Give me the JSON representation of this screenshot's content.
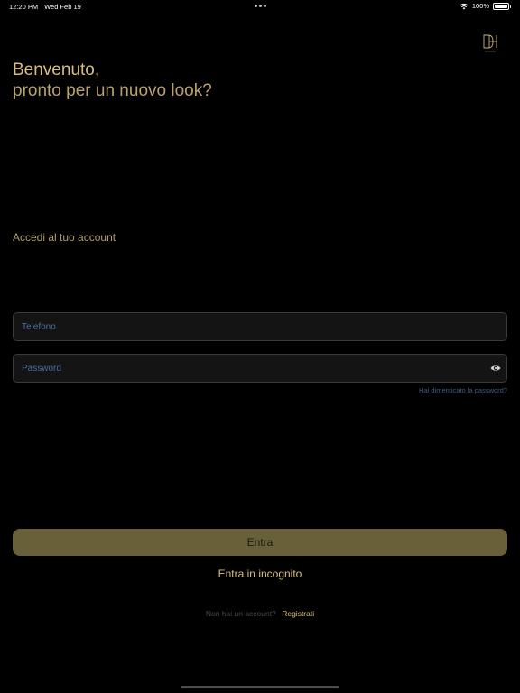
{
  "status": {
    "time": "12:20 PM",
    "date": "Wed Feb 19",
    "battery": "100%"
  },
  "greeting": {
    "line1": "Benvenuto,",
    "line2": "pronto per un nuovo look?"
  },
  "subtitle": "Accedi al tuo account",
  "phone": {
    "placeholder": "Telefono",
    "value": ""
  },
  "password": {
    "placeholder": "Password",
    "value": ""
  },
  "forgot_label": "Hai dimenticato la password?",
  "login_label": "Entra",
  "incognito_label": "Entra in incognito",
  "signup": {
    "question": "Non hai un account?",
    "link": "Registrati"
  },
  "colors": {
    "accent": "#d8c07c",
    "button": "#676038",
    "background": "#000000",
    "placeholder": "#4b6d9c"
  }
}
